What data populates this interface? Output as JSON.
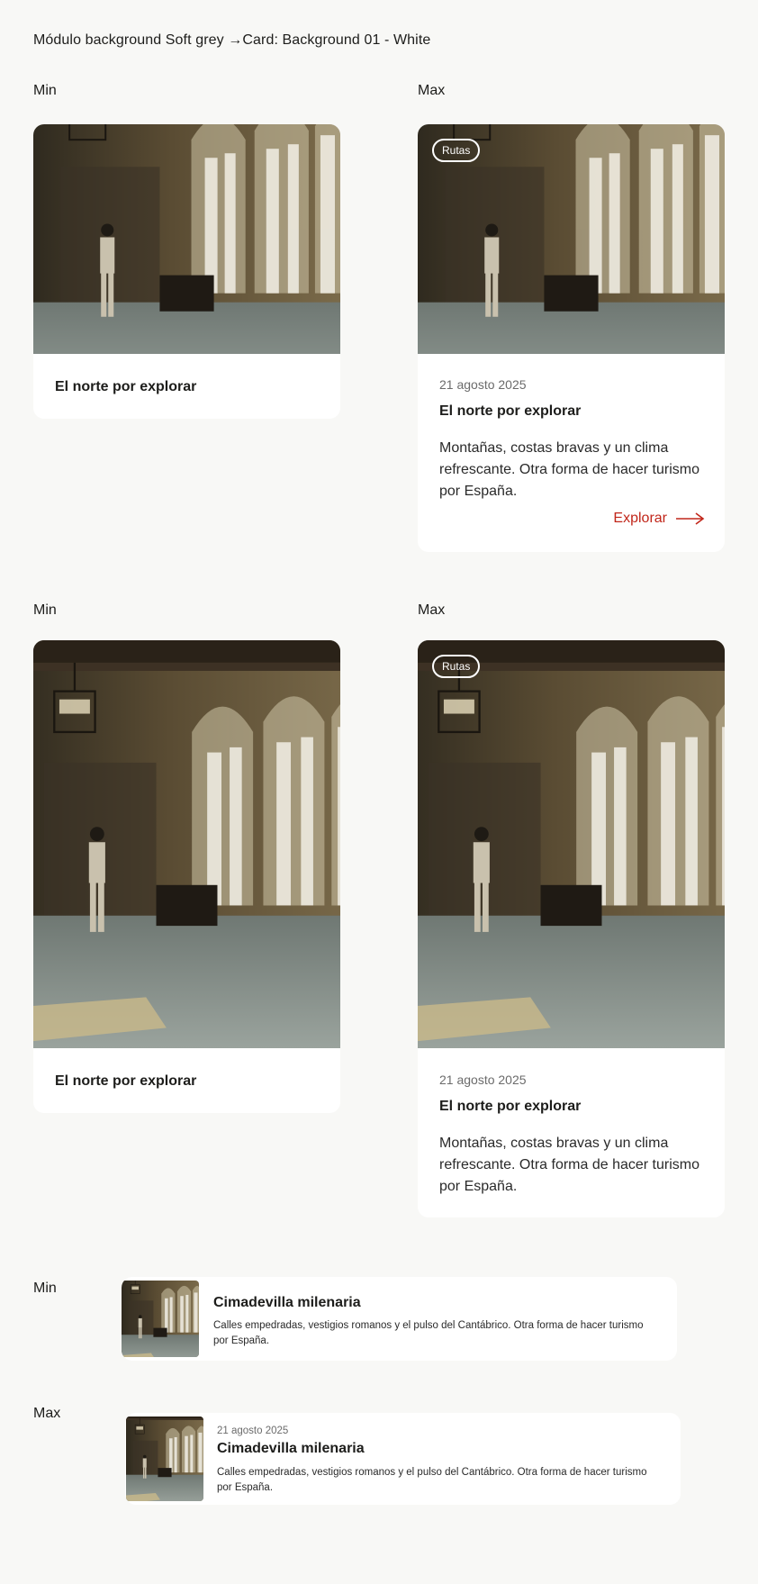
{
  "header": {
    "title": "Módulo background  Soft grey →Card: Background 01 - White"
  },
  "labels": {
    "min": "Min",
    "max": "Max"
  },
  "card": {
    "badge": "Rutas",
    "date": "21 agosto 2025",
    "title": "El norte por explorar",
    "description": "Montañas, costas bravas y un clima refrescante. Otra forma de hacer turismo por España.",
    "cta": "Explorar"
  },
  "horizontal": {
    "date": "21 agosto 2025",
    "title": "Cimadevilla milenaria",
    "description": "Calles empedradas, vestigios romanos y el pulso del Cantábrico. Otra forma de hacer turismo por España."
  },
  "colors": {
    "background": "#f8f8f6",
    "card": "#ffffff",
    "accent": "#c1261a"
  }
}
